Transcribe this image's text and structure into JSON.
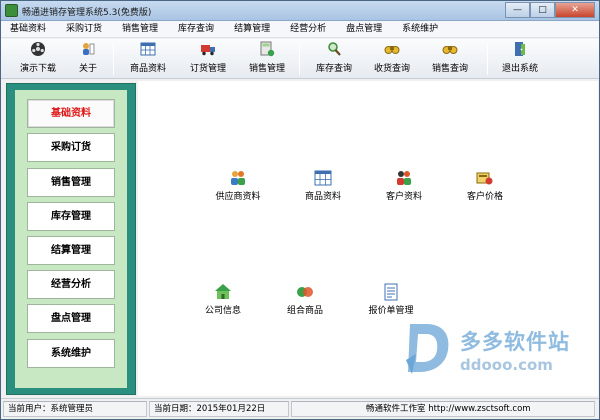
{
  "window": {
    "title": "畅通进销存管理系统5.3(免费版)",
    "minimize_label": "—",
    "maximize_label": "□",
    "close_label": "✕"
  },
  "menu": [
    "基础资料",
    "采购订货",
    "销售管理",
    "库存查询",
    "结算管理",
    "经营分析",
    "盘点管理",
    "系统维护"
  ],
  "toolbar": [
    {
      "label": "演示下载",
      "icon": "film-reel-icon"
    },
    {
      "label": "关于",
      "icon": "info-icon"
    },
    {
      "label": "商品资料",
      "icon": "grid-table-icon"
    },
    {
      "label": "订货管理",
      "icon": "truck-icon"
    },
    {
      "label": "销售管理",
      "icon": "calculator-icon"
    },
    {
      "label": "库存查询",
      "icon": "magnifier-icon"
    },
    {
      "label": "收货查询",
      "icon": "binoculars-icon"
    },
    {
      "label": "销售查询",
      "icon": "binoculars-icon"
    },
    {
      "label": "退出系统",
      "icon": "exit-door-icon"
    }
  ],
  "sidebar": {
    "items": [
      "基础资料",
      "采购订货",
      "销售管理",
      "库存管理",
      "结算管理",
      "经营分析",
      "盘点管理",
      "系统维护"
    ],
    "active": "基础资料"
  },
  "main": {
    "items": [
      {
        "label": "供应商资料",
        "icon": "users-group-icon"
      },
      {
        "label": "商品资料",
        "icon": "grid-table-icon"
      },
      {
        "label": "客户资料",
        "icon": "users-colored-icon"
      },
      {
        "label": "客户价格",
        "icon": "price-tag-icon"
      },
      {
        "label": "公司信息",
        "icon": "house-icon"
      },
      {
        "label": "组合商品",
        "icon": "combine-icon"
      },
      {
        "label": "报价单管理",
        "icon": "document-icon"
      }
    ]
  },
  "watermark": {
    "text": "多多软件站",
    "url": "ddooo.com"
  },
  "statusbar": {
    "user": "当前用户：系统管理员",
    "date": "当前日期：2015年01月22日",
    "company": "畅通软件工作室 http://www.zsctsoft.com"
  },
  "colors": {
    "sidebar_border": "#2b8f7f",
    "sidebar_bg": "#c8e8c4",
    "active_text": "#e01818",
    "watermark": "#8fbbe0"
  }
}
